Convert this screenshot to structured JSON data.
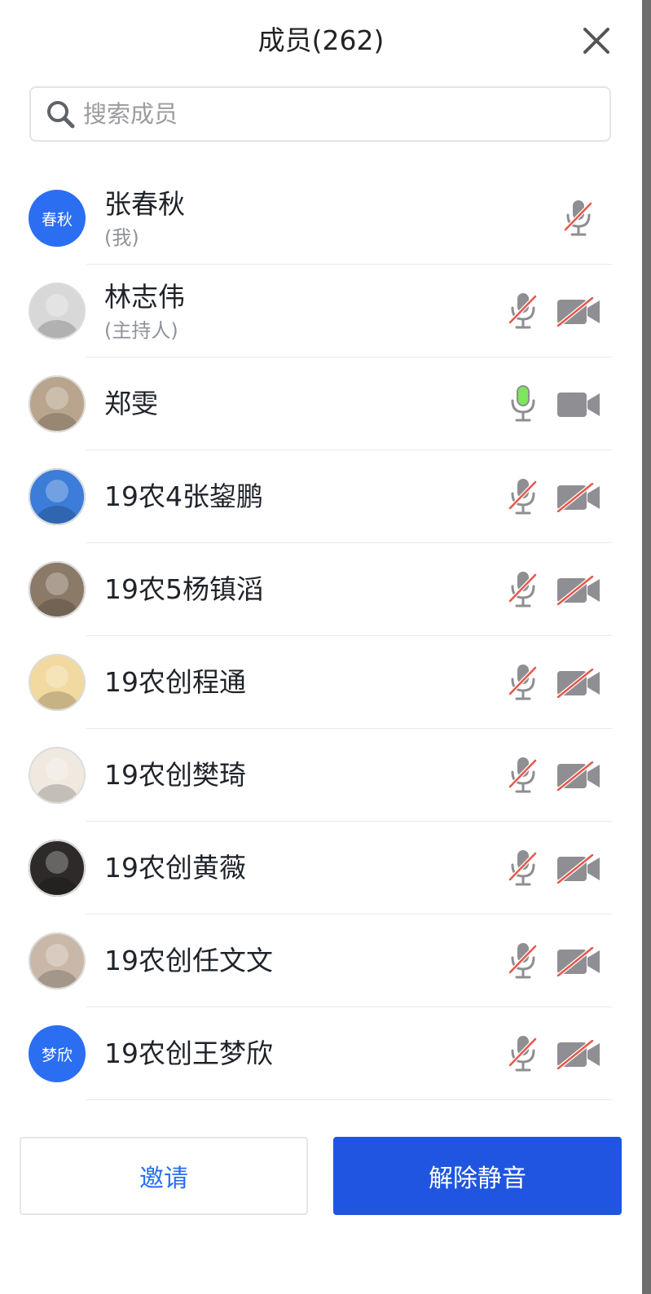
{
  "header": {
    "title": "成员(262)",
    "close_icon": "close-icon"
  },
  "search": {
    "placeholder": "搜索成员",
    "value": ""
  },
  "members": [
    {
      "name": "张春秋",
      "role": "(我)",
      "avatar_text": "春秋",
      "avatar_color": "#2b6ef2",
      "mic": "muted",
      "camera": "none"
    },
    {
      "name": "林志伟",
      "role": "(主持人)",
      "avatar_text": "",
      "avatar_color": "#d8d8d8",
      "mic": "muted",
      "camera": "off"
    },
    {
      "name": "郑雯",
      "role": "",
      "avatar_text": "",
      "avatar_color": "#b9a58d",
      "mic": "speaking",
      "camera": "on"
    },
    {
      "name": "19农4张鋆鹏",
      "role": "",
      "avatar_text": "",
      "avatar_color": "#3b7dd8",
      "mic": "muted",
      "camera": "off"
    },
    {
      "name": "19农5杨镇滔",
      "role": "",
      "avatar_text": "",
      "avatar_color": "#8c7a68",
      "mic": "muted",
      "camera": "off"
    },
    {
      "name": "19农创程通",
      "role": "",
      "avatar_text": "",
      "avatar_color": "#f2d9a0",
      "mic": "muted",
      "camera": "off"
    },
    {
      "name": "19农创樊琦",
      "role": "",
      "avatar_text": "",
      "avatar_color": "#efe9df",
      "mic": "muted",
      "camera": "off"
    },
    {
      "name": "19农创黄薇",
      "role": "",
      "avatar_text": "",
      "avatar_color": "#2d2a29",
      "mic": "muted",
      "camera": "off"
    },
    {
      "name": "19农创任文文",
      "role": "",
      "avatar_text": "",
      "avatar_color": "#c9b8a8",
      "mic": "muted",
      "camera": "off"
    },
    {
      "name": "19农创王梦欣",
      "role": "",
      "avatar_text": "梦欣",
      "avatar_color": "#2b6ef2",
      "mic": "muted",
      "camera": "off"
    }
  ],
  "footer": {
    "invite_label": "邀请",
    "unmute_all_label": "解除静音"
  },
  "colors": {
    "accent": "#2b6ef2",
    "primary_button": "#1f55e0",
    "muted_slash": "#e8574a",
    "speaking": "#7ee65a",
    "icon_gray": "#8e8e93"
  }
}
